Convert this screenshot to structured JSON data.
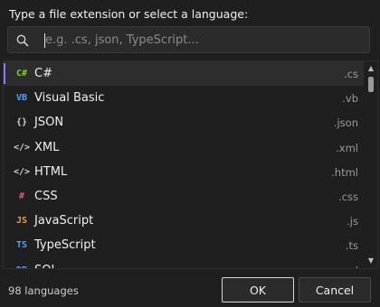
{
  "dialog": {
    "prompt": "Type a file extension or select a language:",
    "search": {
      "placeholder": "e.g. .cs, json, TypeScript...",
      "value": ""
    },
    "languages": [
      {
        "glyph": "C#",
        "glyph_color": "#7ed321",
        "icon": "csharp-icon",
        "name": "C#",
        "ext": ".cs"
      },
      {
        "glyph": "VB",
        "glyph_color": "#4aa3ff",
        "icon": "vb-icon",
        "name": "Visual Basic",
        "ext": ".vb"
      },
      {
        "glyph": "{}",
        "glyph_color": "#d0d0d0",
        "icon": "json-file-icon",
        "name": "JSON",
        "ext": ".json"
      },
      {
        "glyph": "</>",
        "glyph_color": "#d0d0d0",
        "icon": "xml-file-icon",
        "name": "XML",
        "ext": ".xml"
      },
      {
        "glyph": "</>",
        "glyph_color": "#d0d0d0",
        "icon": "html-file-icon",
        "name": "HTML",
        "ext": ".html"
      },
      {
        "glyph": "#",
        "glyph_color": "#e06666",
        "icon": "css-file-icon",
        "name": "CSS",
        "ext": ".css"
      },
      {
        "glyph": "JS",
        "glyph_color": "#e8a03c",
        "icon": "javascript-icon",
        "name": "JavaScript",
        "ext": ".js"
      },
      {
        "glyph": "TS",
        "glyph_color": "#4aa3ff",
        "icon": "typescript-icon",
        "name": "TypeScript",
        "ext": ".ts"
      },
      {
        "glyph": "DB",
        "glyph_color": "#4aa3ff",
        "icon": "sql-icon",
        "name": "SQL",
        "ext": ".sql"
      }
    ],
    "selected_index": 0,
    "count_label": "98 languages",
    "ok_label": "OK",
    "cancel_label": "Cancel"
  },
  "colors": {
    "background": "#1f1f1f",
    "selection_accent": "#8b7bff"
  }
}
